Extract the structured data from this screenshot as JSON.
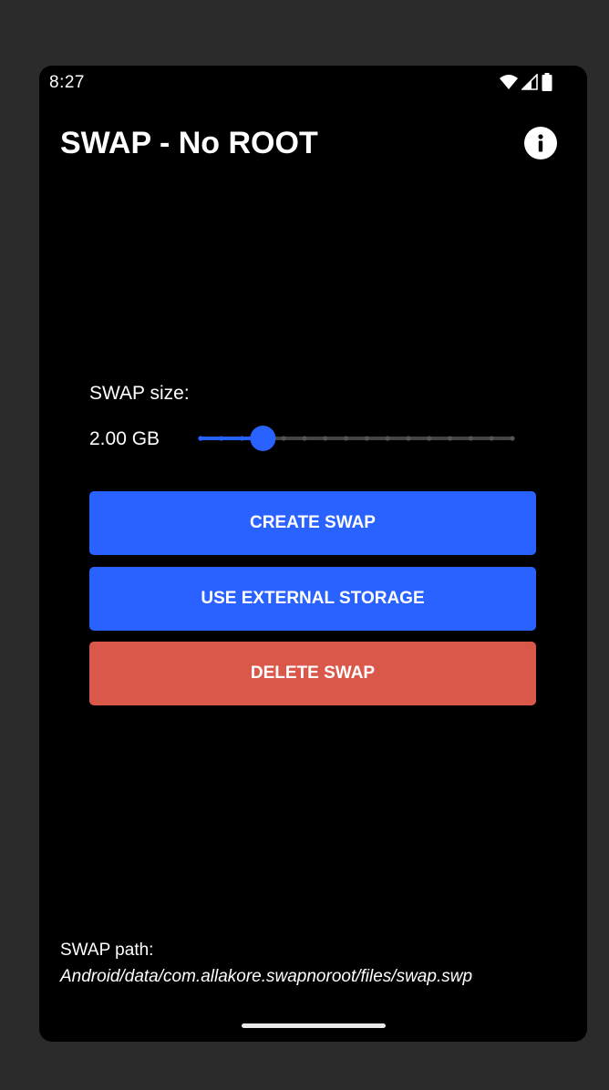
{
  "status_bar": {
    "time": "8:27",
    "icons": [
      "wifi-icon",
      "signal-icon",
      "battery-icon"
    ]
  },
  "app_bar": {
    "title": "SWAP - No ROOT",
    "info_icon": "info-icon"
  },
  "swap_size": {
    "label": "SWAP size:",
    "value_text": "2.00 GB",
    "slider": {
      "steps": 16,
      "selected_index": 3
    }
  },
  "buttons": {
    "create": "CREATE SWAP",
    "external": "USE EXTERNAL STORAGE",
    "delete": "DELETE SWAP"
  },
  "footer": {
    "path_label": "SWAP path:",
    "path_value": "Android/data/com.allakore.swapnoroot/files/swap.swp"
  },
  "colors": {
    "primary": "#2962ff",
    "danger": "#d9584a",
    "track_inactive": "#444444",
    "background": "#000000"
  }
}
